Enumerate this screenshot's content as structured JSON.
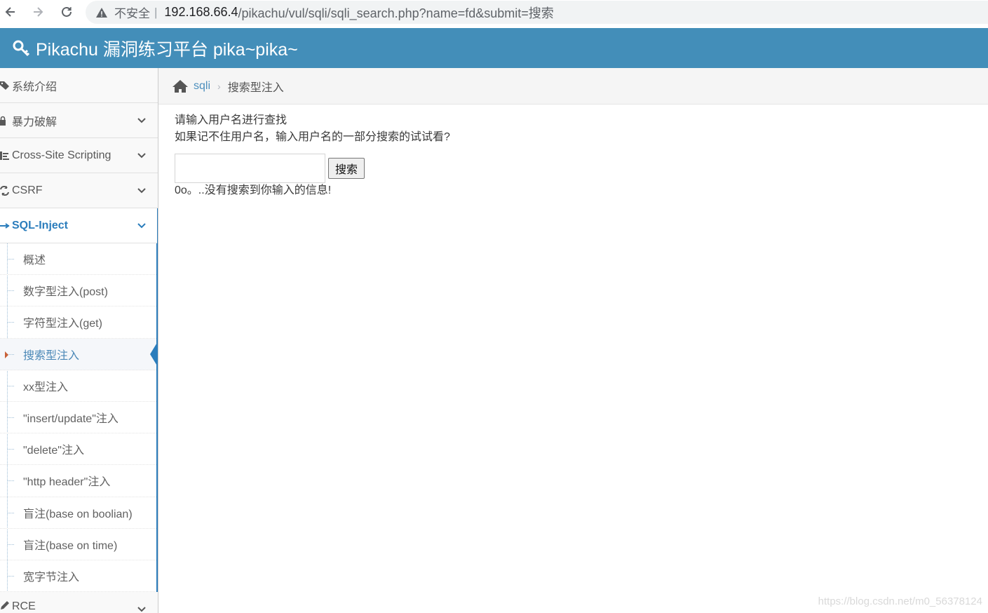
{
  "browser": {
    "insecure_label": "不安全",
    "separator": "|",
    "url_host": "192.168.66.4",
    "url_path": "/pikachu/vul/sqli/sqli_search.php?name=fd&submit=搜索"
  },
  "header": {
    "title": "Pikachu 漏洞练习平台 pika~pika~",
    "bg_color": "#438eb9"
  },
  "sidebar": {
    "items": [
      {
        "label": "系统介绍",
        "icon": "tag-icon"
      },
      {
        "label": "暴力破解",
        "icon": "lock-icon"
      },
      {
        "label": "Cross-Site Scripting",
        "icon": "list-icon"
      },
      {
        "label": "CSRF",
        "icon": "exchange-icon"
      },
      {
        "label": "SQL-Inject",
        "icon": "syringe-icon",
        "active": true
      },
      {
        "label": "RCE",
        "icon": "pencil-icon"
      }
    ],
    "sqli_subitems": [
      "概述",
      "数字型注入(post)",
      "字符型注入(get)",
      "搜索型注入",
      "xx型注入",
      "\"insert/update\"注入",
      "\"delete\"注入",
      "\"http header\"注入",
      "盲注(base on boolian)",
      "盲注(base on time)",
      "宽字节注入"
    ],
    "current_subitem": "搜索型注入"
  },
  "breadcrumb": {
    "link": "sqli",
    "current": "搜索型注入"
  },
  "main": {
    "line1": "请输入用户名进行查找",
    "line2": "如果记不住用户名，输入用户名的一部分搜索的试试看?",
    "search_value": "",
    "search_button": "搜索",
    "result": "0o。..没有搜索到你输入的信息!"
  },
  "watermark": "https://blog.csdn.net/m0_56378124"
}
